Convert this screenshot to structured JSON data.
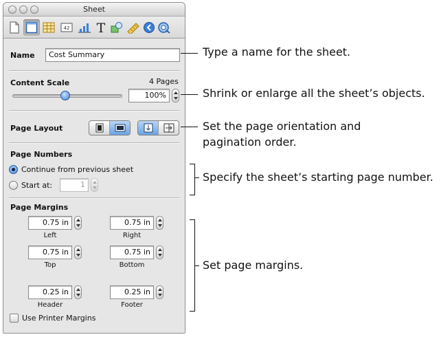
{
  "window": {
    "title": "Sheet"
  },
  "toolbar": {
    "icons": [
      "document-inspector-icon",
      "sheet-inspector-icon",
      "table-inspector-icon",
      "cell-format-inspector-icon",
      "chart-inspector-icon",
      "text-inspector-icon",
      "graphic-inspector-icon",
      "metrics-inspector-icon",
      "hyperlink-inspector-icon",
      "quicktime-inspector-icon"
    ]
  },
  "name_section": {
    "label": "Name",
    "value": "Cost Summary"
  },
  "content_scale": {
    "label": "Content Scale",
    "pages": "4 Pages",
    "value": "100%",
    "slider_fraction": 0.48
  },
  "page_layout": {
    "label": "Page Layout"
  },
  "page_numbers": {
    "label": "Page Numbers",
    "continue_label": "Continue from previous sheet",
    "start_label": "Start at:",
    "start_value": "1"
  },
  "page_margins": {
    "label": "Page Margins",
    "left": {
      "value": "0.75 in",
      "label": "Left"
    },
    "right": {
      "value": "0.75 in",
      "label": "Right"
    },
    "top": {
      "value": "0.75 in",
      "label": "Top"
    },
    "bottom": {
      "value": "0.75 in",
      "label": "Bottom"
    },
    "header": {
      "value": "0.25 in",
      "label": "Header"
    },
    "footer": {
      "value": "0.25 in",
      "label": "Footer"
    },
    "printer_margins_label": "Use Printer Margins"
  },
  "callouts": {
    "name": "Type a name for the sheet.",
    "scale": "Shrink or enlarge all the sheet’s objects.",
    "layout_line1": "Set the page orientation and",
    "layout_line2": "pagination order.",
    "numbers": "Specify the sheet’s starting page number.",
    "margins": "Set page margins."
  },
  "colors": {
    "accent": "#3b7fd8",
    "panel": "#e6e6e6"
  }
}
